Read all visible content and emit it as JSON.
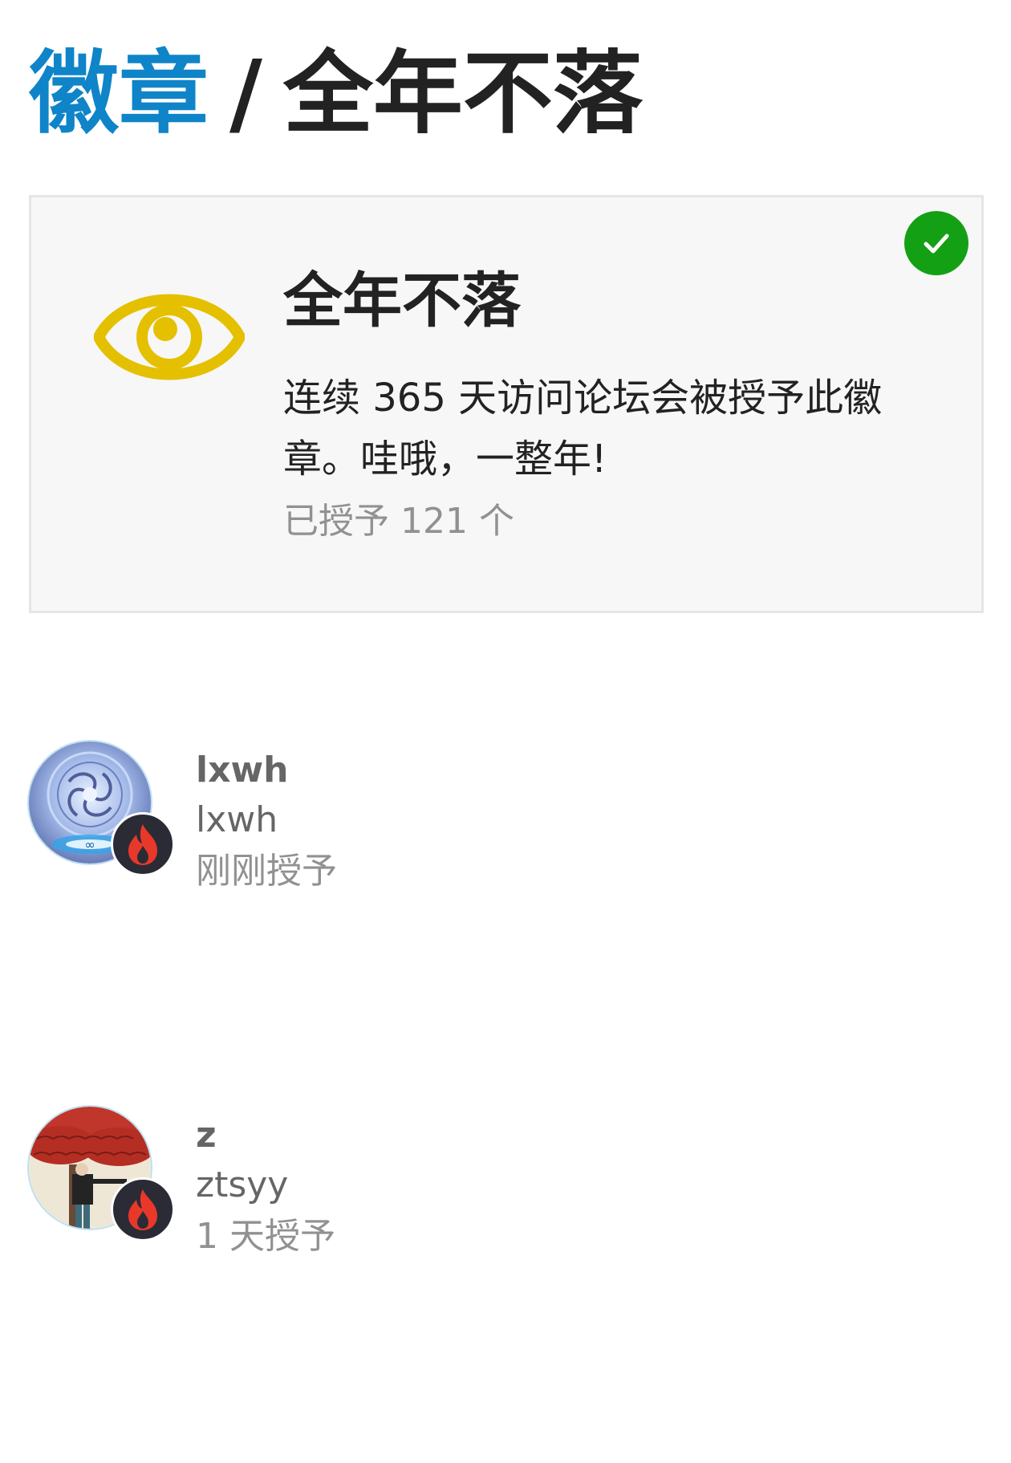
{
  "breadcrumb": {
    "parent": "徽章",
    "separator": "/",
    "current": "全年不落"
  },
  "badge": {
    "icon": "eye-icon",
    "icon_color": "#e4c000",
    "granted_icon": "check-icon",
    "granted_color": "#14a014",
    "name": "全年不落",
    "description": "连续 365 天访问论坛会被授予此徽章。哇哦，一整年!",
    "granted_count_text": "已授予 121 个"
  },
  "users": [
    {
      "display_name": "lxwh",
      "username": "lxwh",
      "granted_when": "刚刚授予",
      "avatar": "spiral-portal-avatar",
      "mini_badge": "fire-icon"
    },
    {
      "display_name": "z",
      "username": "ztsyy",
      "granted_when": "1 天授予",
      "avatar": "red-tree-avatar",
      "mini_badge": "fire-icon"
    }
  ],
  "colors": {
    "link": "#0f84c8",
    "text": "#222222",
    "muted": "#919191",
    "card_bg": "#f7f7f7",
    "fire": "#e8382a"
  }
}
